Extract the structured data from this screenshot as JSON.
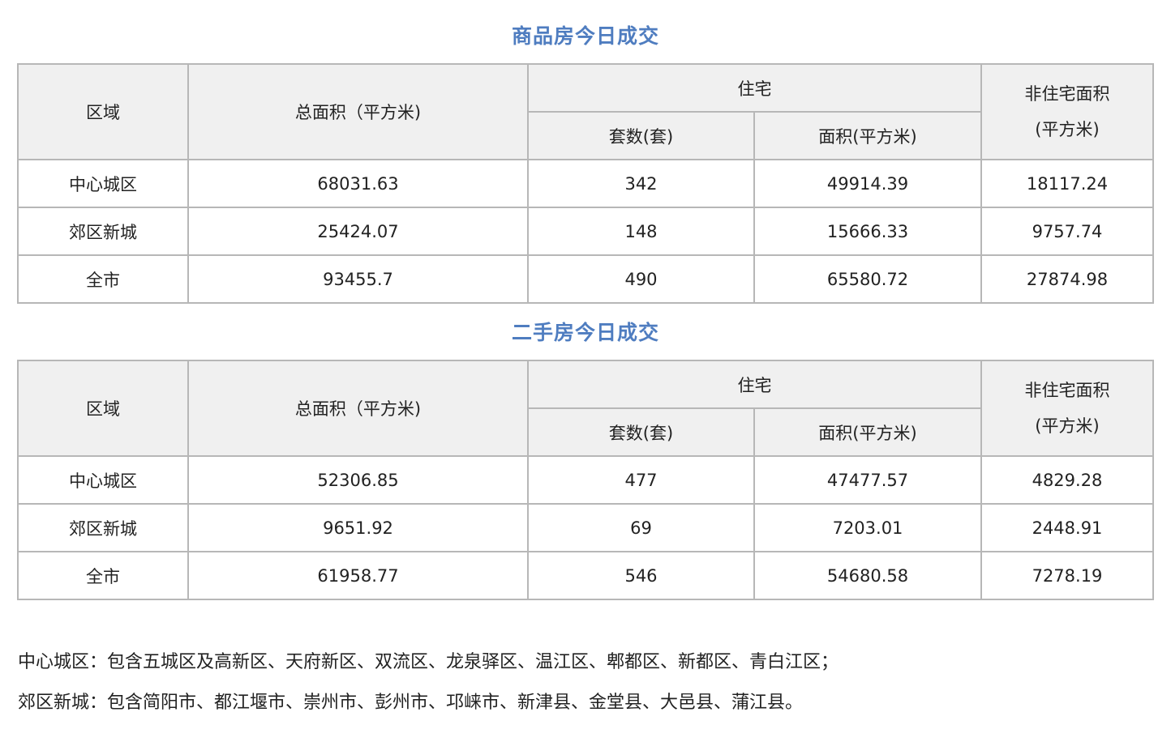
{
  "sections": [
    {
      "title": "商品房今日成交",
      "headers": {
        "region": "区域",
        "total_area": "总面积（平方米)",
        "residential": "住宅",
        "units": "套数(套)",
        "res_area": "面积(平方米)",
        "non_res_line1": "非住宅面积",
        "non_res_line2": "(平方米)"
      },
      "rows": [
        {
          "region": "中心城区",
          "total_area": "68031.63",
          "units": "342",
          "res_area": "49914.39",
          "non_res": "18117.24"
        },
        {
          "region": "郊区新城",
          "total_area": "25424.07",
          "units": "148",
          "res_area": "15666.33",
          "non_res": "9757.74"
        },
        {
          "region": "全市",
          "total_area": "93455.7",
          "units": "490",
          "res_area": "65580.72",
          "non_res": "27874.98"
        }
      ]
    },
    {
      "title": "二手房今日成交",
      "headers": {
        "region": "区域",
        "total_area": "总面积（平方米)",
        "residential": "住宅",
        "units": "套数(套)",
        "res_area": "面积(平方米)",
        "non_res_line1": "非住宅面积",
        "non_res_line2": "(平方米)"
      },
      "rows": [
        {
          "region": "中心城区",
          "total_area": "52306.85",
          "units": "477",
          "res_area": "47477.57",
          "non_res": "4829.28"
        },
        {
          "region": "郊区新城",
          "total_area": "9651.92",
          "units": "69",
          "res_area": "7203.01",
          "non_res": "2448.91"
        },
        {
          "region": "全市",
          "total_area": "61958.77",
          "units": "546",
          "res_area": "54680.58",
          "non_res": "7278.19"
        }
      ]
    }
  ],
  "notes": [
    "中心城区：包含五城区及高新区、天府新区、双流区、龙泉驿区、温江区、郫都区、新都区、青白江区；",
    "郊区新城：包含简阳市、都江堰市、崇州市、彭州市、邛崃市、新津县、金堂县、大邑县、蒲江县。"
  ],
  "colors": {
    "title": "#4f7dc0",
    "header_bg": "#f0f0f0",
    "border": "#b7b7b7"
  }
}
